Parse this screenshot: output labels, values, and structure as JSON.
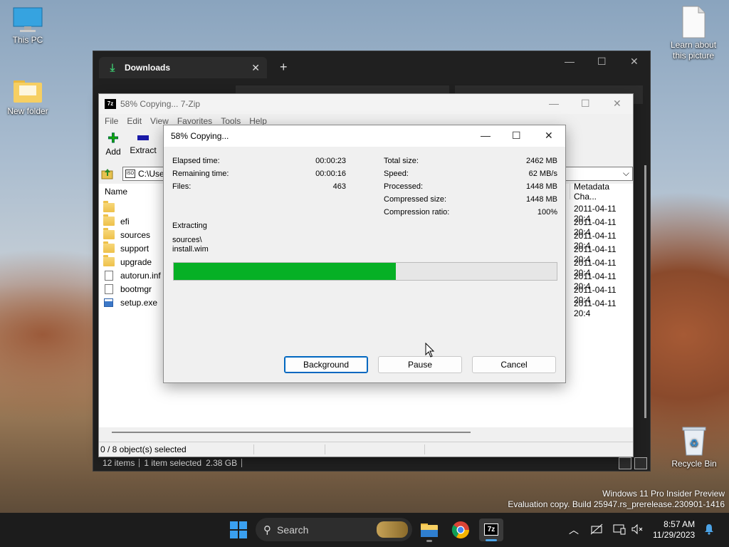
{
  "desktop": {
    "icons": [
      {
        "label": "This PC",
        "icon": "monitor-icon"
      },
      {
        "label": "New folder",
        "icon": "folder-icon"
      },
      {
        "label": "Learn about this picture",
        "icon": "file-icon"
      },
      {
        "label": "Recycle Bin",
        "icon": "recycle-bin-icon"
      }
    ],
    "watermark": {
      "line1": "Windows 11 Pro Insider Preview",
      "line2": "Evaluation copy. Build 25947.rs_prerelease.230901-1416"
    }
  },
  "explorer": {
    "tab_title": "Downloads",
    "tab_icon": "download-icon",
    "new_tab": "+",
    "status": {
      "items": "12 items",
      "selected": "1 item selected",
      "size": "2.38 GB"
    }
  },
  "sevenzip": {
    "title": "58% Copying... 7-Zip",
    "logo": "7z",
    "menu": [
      "File",
      "Edit",
      "View",
      "Favorites",
      "Tools",
      "Help"
    ],
    "toolbar": {
      "add": "Add",
      "extract": "Extract"
    },
    "address": "C:\\Use",
    "columns": {
      "name": "Name",
      "metadata": "Metadata Cha..."
    },
    "rows": [
      {
        "name": "",
        "type": "folder",
        "meta": "2011-04-11 20:4"
      },
      {
        "name": "efi",
        "type": "folder",
        "meta": "2011-04-11 20:4"
      },
      {
        "name": "sources",
        "type": "folder",
        "meta": "2011-04-11 20:4"
      },
      {
        "name": "support",
        "type": "folder",
        "meta": "2011-04-11 20:4"
      },
      {
        "name": "upgrade",
        "type": "folder",
        "meta": "2011-04-11 20:4"
      },
      {
        "name": "autorun.inf",
        "type": "file",
        "meta": "2011-04-11 20:4"
      },
      {
        "name": "bootmgr",
        "type": "file",
        "meta": "2011-04-11 20:4"
      },
      {
        "name": "setup.exe",
        "type": "exe",
        "meta": "2011-04-11 20:4"
      }
    ],
    "status": "0 / 8 object(s) selected"
  },
  "dialog": {
    "title": "58% Copying...",
    "left_stats": [
      {
        "label": "Elapsed time:",
        "value": "00:00:23"
      },
      {
        "label": "Remaining time:",
        "value": "00:00:16"
      },
      {
        "label": "Files:",
        "value": "463"
      }
    ],
    "right_stats": [
      {
        "label": "Total size:",
        "value": "2462 MB"
      },
      {
        "label": "Speed:",
        "value": "62 MB/s"
      },
      {
        "label": "Processed:",
        "value": "1448 MB"
      },
      {
        "label": "Compressed size:",
        "value": "1448 MB"
      },
      {
        "label": "Compression ratio:",
        "value": "100%"
      }
    ],
    "operation": "Extracting",
    "path_line1": "sources\\",
    "path_line2": "install.wim",
    "progress": 0.58,
    "progress_color": "#06b025",
    "buttons": {
      "background": "Background",
      "pause": "Pause",
      "cancel": "Cancel"
    }
  },
  "taskbar": {
    "search_placeholder": "Search",
    "apps": [
      "windows-start-icon",
      "file-explorer-icon",
      "chrome-icon",
      "7zip-icon"
    ],
    "time": "8:57 AM",
    "date": "11/29/2023"
  }
}
